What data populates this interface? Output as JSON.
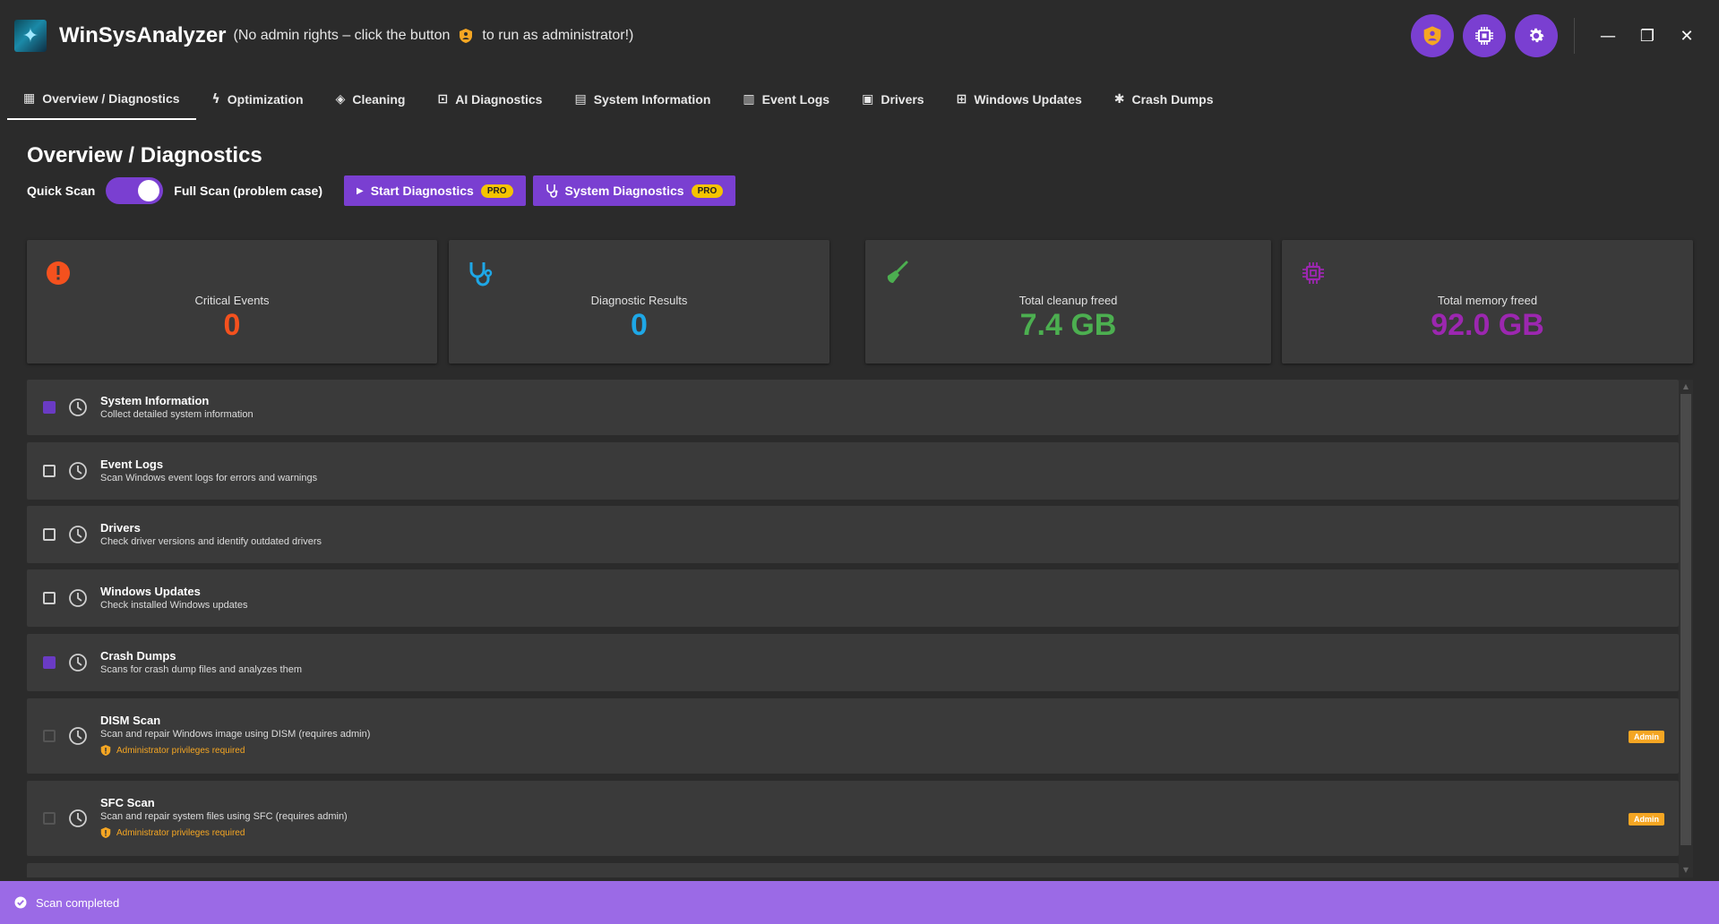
{
  "app": {
    "title": "WinSysAnalyzer",
    "note_before": "(No admin rights – click the button",
    "note_after": "to run as administrator!)"
  },
  "header_buttons": [
    {
      "icon": "shield-user-icon"
    },
    {
      "icon": "cpu-icon"
    },
    {
      "icon": "gear-icon"
    }
  ],
  "window": {
    "minimize": "—",
    "restore": "❐",
    "close": "✕"
  },
  "tabs": [
    {
      "label": "Overview / Diagnostics",
      "icon": "chart-icon"
    },
    {
      "label": "Optimization",
      "icon": "bolt-icon"
    },
    {
      "label": "Cleaning",
      "icon": "eraser-icon"
    },
    {
      "label": "AI Diagnostics",
      "icon": "robot-icon"
    },
    {
      "label": "System Information",
      "icon": "monitor-icon"
    },
    {
      "label": "Event Logs",
      "icon": "document-icon"
    },
    {
      "label": "Drivers",
      "icon": "driver-icon"
    },
    {
      "label": "Windows Updates",
      "icon": "update-icon"
    },
    {
      "label": "Crash Dumps",
      "icon": "crash-icon"
    }
  ],
  "page": {
    "title": "Overview / Diagnostics",
    "quick_scan": "Quick Scan",
    "full_scan": "Full Scan (problem case)",
    "start_diag": "Start Diagnostics",
    "system_diag": "System Diagnostics",
    "pro": "PRO"
  },
  "stats": [
    {
      "label": "Critical Events",
      "value": "0",
      "color": "#f4511e",
      "icon": "alert-icon"
    },
    {
      "label": "Diagnostic Results",
      "value": "0",
      "color": "#1ea7e6",
      "icon": "stethoscope-icon"
    },
    {
      "label": "Total cleanup freed",
      "value": "7.4 GB",
      "color": "#4caf50",
      "icon": "broom-icon"
    },
    {
      "label": "Total memory freed",
      "value": "92.0 GB",
      "color": "#9c27b0",
      "icon": "memory-chip-icon"
    }
  ],
  "tasks": [
    {
      "name": "System Information",
      "desc": "Collect detailed system information",
      "checked": true
    },
    {
      "name": "Event Logs",
      "desc": "Scan Windows event logs for errors and warnings",
      "checked": false
    },
    {
      "name": "Drivers",
      "desc": "Check driver versions and identify outdated drivers",
      "checked": false
    },
    {
      "name": "Windows Updates",
      "desc": "Check installed Windows updates",
      "checked": false
    },
    {
      "name": "Crash Dumps",
      "desc": "Scans for crash dump files and analyzes them",
      "checked": true
    },
    {
      "name": "DISM Scan",
      "desc": "Scan and repair Windows image using DISM (requires admin)",
      "admin_note": "Administrator privileges required",
      "badge": "Admin"
    },
    {
      "name": "SFC Scan",
      "desc": "Scan and repair system files using SFC (requires admin)",
      "admin_note": "Administrator privileges required",
      "badge": "Admin"
    }
  ],
  "status": {
    "text": "Scan completed"
  }
}
